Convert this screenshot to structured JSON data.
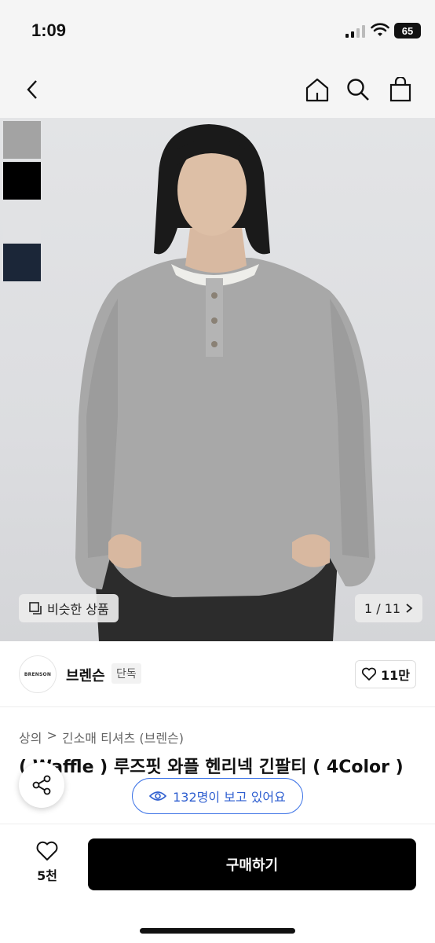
{
  "status_bar": {
    "time": "1:09",
    "battery": "65"
  },
  "nav": {
    "back_icon": "chevron-left-icon",
    "home_icon": "home-icon",
    "search_icon": "search-icon",
    "bag_icon": "shopping-bag-icon"
  },
  "gallery": {
    "swatch_colors": [
      "#a3a3a3",
      "#000000",
      "#e1e2e4",
      "#1b2638"
    ],
    "similar_label": "비슷한 상품",
    "pager": "1 / 11"
  },
  "brand": {
    "logo_text": "BRENSON",
    "name": "브렌슨",
    "badge": "단독",
    "likes": "11만"
  },
  "breadcrumb": {
    "category": "상의",
    "separator": ">",
    "subcategory": "긴소매 티셔츠 (브렌슨)"
  },
  "product": {
    "title": "( Waffle ) 루즈핏 와플 헨리넥 긴팔티 ( 4Color )"
  },
  "viewers": {
    "text": "132명이 보고 있어요"
  },
  "bottom": {
    "wish_count": "5천",
    "buy_label": "구매하기"
  },
  "colors": {
    "accent": "#3b72e6",
    "buy_button": "#000000"
  }
}
